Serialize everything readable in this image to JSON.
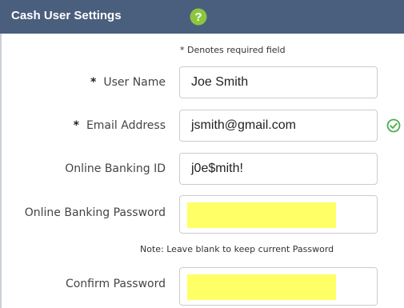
{
  "header": {
    "title": "Cash User Settings",
    "help_icon": "question-circle-icon"
  },
  "form": {
    "required_note": "* Denotes required field",
    "required_marker": "*",
    "username": {
      "label": "User Name",
      "value": "Joe Smith",
      "required": true
    },
    "email": {
      "label": "Email Address",
      "value": "jsmith@gmail.com",
      "required": true,
      "status_icon": "check-circle-icon"
    },
    "banking_id": {
      "label": "Online Banking ID",
      "value": "j0e$mith!"
    },
    "password": {
      "label": "Online Banking Password",
      "value": ""
    },
    "password_note": "Note: Leave blank to keep current Password",
    "confirm_password": {
      "label": "Confirm Password",
      "value": ""
    }
  },
  "colors": {
    "header_bg": "#4a5e7d",
    "help_icon": "#8cc63f",
    "check_icon": "#4caf50",
    "redaction": "#ffff66"
  }
}
